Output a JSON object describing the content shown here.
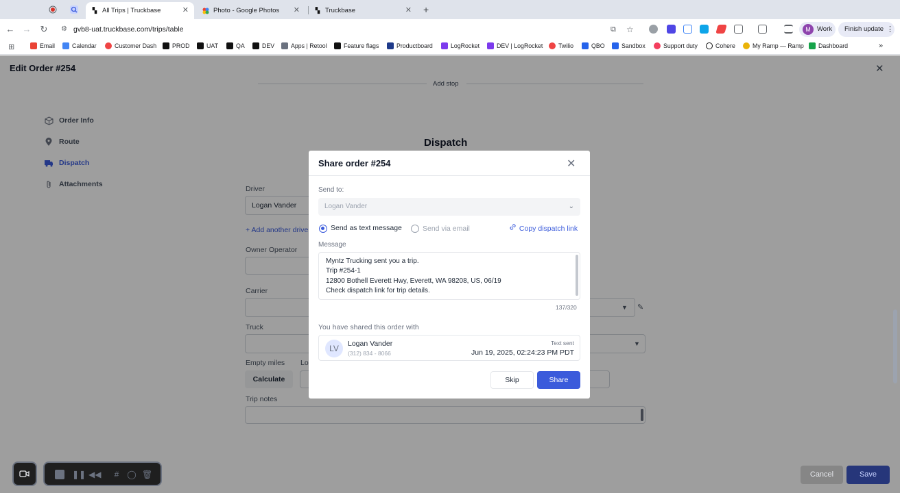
{
  "browser": {
    "tabs": [
      {
        "title": "All Trips | Truckbase",
        "active": true
      },
      {
        "title": "Photo - Google Photos",
        "active": false
      },
      {
        "title": "Truckbase",
        "active": false
      }
    ],
    "new_tab": "+",
    "url": "gvb8-uat.truckbase.com/trips/table",
    "profile": {
      "initial": "M",
      "name": "Work"
    },
    "finish_update": "Finish update",
    "bookmarks": [
      "Email",
      "Calendar",
      "Customer Dash",
      "PROD",
      "UAT",
      "QA",
      "DEV",
      "Apps | Retool",
      "Feature flags",
      "Productboard",
      "LogRocket",
      "DEV | LogRocket",
      "Twilio",
      "QBO",
      "Sandbox",
      "Support duty",
      "Cohere",
      "My Ramp — Ramp",
      "Dashboard"
    ],
    "more_bookmarks": "»"
  },
  "app": {
    "title": "Edit Order #254",
    "add_stop": "Add stop",
    "sidebar": [
      {
        "label": "Order Info",
        "icon": "box-icon",
        "active": false
      },
      {
        "label": "Route",
        "icon": "pin-icon",
        "active": false
      },
      {
        "label": "Dispatch",
        "icon": "truck-icon",
        "active": true
      },
      {
        "label": "Attachments",
        "icon": "paperclip-icon",
        "active": false
      }
    ],
    "section_title": "Dispatch",
    "driver_label": "Driver",
    "driver_value": "Logan Vander",
    "add_driver": "+ Add another drive",
    "owner_operator_label": "Owner Operator",
    "carrier_label": "Carrier",
    "truck_label": "Truck",
    "empty_miles_label": "Empty miles",
    "loaded_miles_label_partial": "Lo",
    "calculate": "Calculate",
    "trip_notes_label": "Trip notes",
    "cancel": "Cancel",
    "save": "Save"
  },
  "modal": {
    "title": "Share order #254",
    "send_to_label": "Send to:",
    "send_to_value": "Logan Vander",
    "option_text": "Send as text message",
    "option_email": "Send via email",
    "copy_link": "Copy dispatch link",
    "message_label": "Message",
    "message_lines": [
      "Myntz Trucking sent you a trip.",
      "Trip #254-1",
      "12800 Bothell Everett Hwy, Everett, WA 98208, US, 06/19",
      "Check dispatch link for trip details."
    ],
    "counter": "137/320",
    "shared_with_label": "You have shared this order with",
    "shared": {
      "initials": "LV",
      "name": "Logan Vander",
      "phone": "(312) 834 - 8066",
      "status": "Text sent",
      "date": "Jun 19, 2025, 02:24:23 PM PDT"
    },
    "skip": "Skip",
    "share": "Share"
  },
  "colors": {
    "accent": "#3b5bdb",
    "overlay": "rgba(0,0,0,0.38)"
  }
}
